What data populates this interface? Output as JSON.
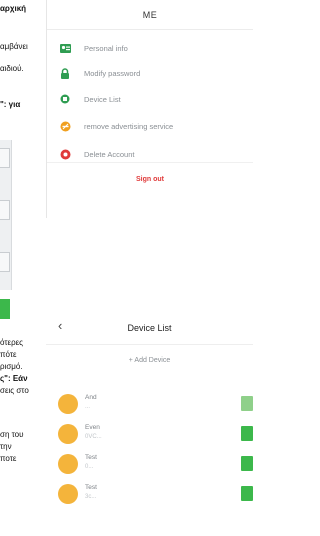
{
  "left_text": {
    "lines": [
      {
        "text": "αρχική",
        "bold": true
      },
      {
        "text": "αμβάνει",
        "bold": false
      },
      {
        "text": "αιδιού.",
        "bold": false
      },
      {
        "text": "\": για",
        "bold": true
      },
      {
        "text": "ότερες",
        "bold": false
      },
      {
        "text": "πότε",
        "bold": false
      },
      {
        "text": "ρισμό.",
        "bold": false
      },
      {
        "text": "ς\": Εάν",
        "bold": true
      },
      {
        "text": "σεις στο",
        "bold": false
      },
      {
        "text": "ση του",
        "bold": false
      },
      {
        "text": "την",
        "bold": false
      },
      {
        "text": "ποτε",
        "bold": false
      }
    ]
  },
  "me_panel": {
    "title": "ME",
    "menu": [
      {
        "label": "Personal info",
        "icon": "personal-info-icon",
        "color": "#2f9d52"
      },
      {
        "label": "Modify password",
        "icon": "lock-icon",
        "color": "#2f9d52"
      },
      {
        "label": "Device List",
        "icon": "device-list-icon",
        "color": "#2f9d52"
      },
      {
        "label": "remove advertising service",
        "icon": "ad-remove-icon",
        "color": "#f0a020"
      },
      {
        "label": "Delete Account",
        "icon": "delete-account-icon",
        "color": "#e03a3a"
      }
    ],
    "sign_out": "Sign out"
  },
  "device_list": {
    "title": "Device List",
    "add_label": "+ Add Device",
    "devices": [
      {
        "name": "And",
        "sub": "...",
        "toggle_on": false
      },
      {
        "name": "Even",
        "sub": "0VC...",
        "toggle_on": true
      },
      {
        "name": "Test",
        "sub": "0...",
        "toggle_on": true
      },
      {
        "name": "Test",
        "sub": "3c...",
        "toggle_on": true
      }
    ]
  },
  "colors": {
    "accent_green": "#3cb84b",
    "danger_red": "#e03a3a",
    "avatar_orange": "#f4b43b"
  }
}
